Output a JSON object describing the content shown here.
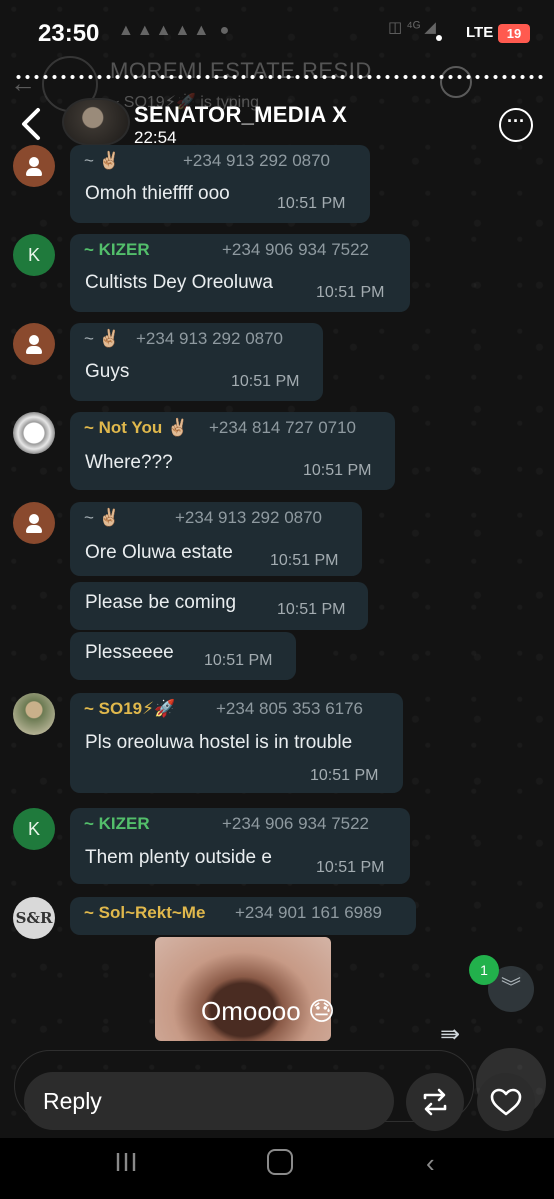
{
  "status_bar": {
    "time": "23:50",
    "network": "LTE",
    "battery": "19"
  },
  "background_chat": {
    "title": "MOREMI ESTATE RESID",
    "typing_status": "~ SO19⚡🚀 is typing"
  },
  "story_header": {
    "name": "SENATOR_MEDIA X",
    "time": "22:54"
  },
  "messages": [
    {
      "sender": "~ ✌🏼",
      "phone": "+234 913 292 0870",
      "text": "Omoh thieffff ooo",
      "time": "10:51 PM"
    },
    {
      "sender": "~ KIZER",
      "phone": "+234 906 934 7522",
      "text": "Cultists Dey Oreoluwa",
      "time": "10:51 PM"
    },
    {
      "sender": "~ ✌🏼",
      "phone": "+234 913 292 0870",
      "text": "Guys",
      "time": "10:51 PM"
    },
    {
      "sender": "~ Not You ✌🏼",
      "phone": "+234 814 727 0710",
      "text": "Where???",
      "time": "10:51 PM"
    },
    {
      "sender": "~ ✌🏼",
      "phone": "+234 913 292 0870",
      "text": "Ore Oluwa estate",
      "time": "10:51 PM"
    },
    {
      "text": "Please be coming",
      "time": "10:51 PM"
    },
    {
      "text": "Plesseeee",
      "time": "10:51 PM"
    },
    {
      "sender": "~ SO19⚡",
      "phone": "+234 805 353 6176",
      "text": "Pls oreoluwa hostel is in trouble",
      "time": "10:51 PM"
    },
    {
      "sender": "~ KIZER",
      "phone": "+234 906 934 7522",
      "text": "Them plenty outside e",
      "time": "10:51 PM"
    },
    {
      "sender": "~ Sol~Rekt~Me",
      "phone": "+234 901 161 6989"
    }
  ],
  "avatars": {
    "kizer_letter": "K",
    "sol_logo": "S&R"
  },
  "story_caption": "Omoooo 😓",
  "unread_count": "1",
  "reply": {
    "placeholder": "Reply"
  },
  "colors": {
    "bubble": "#1f2c33",
    "sender_green": "#53bf6b",
    "sender_gold": "#e0b84c",
    "badge": "#22b14c",
    "battery": "#ff5a4f"
  }
}
